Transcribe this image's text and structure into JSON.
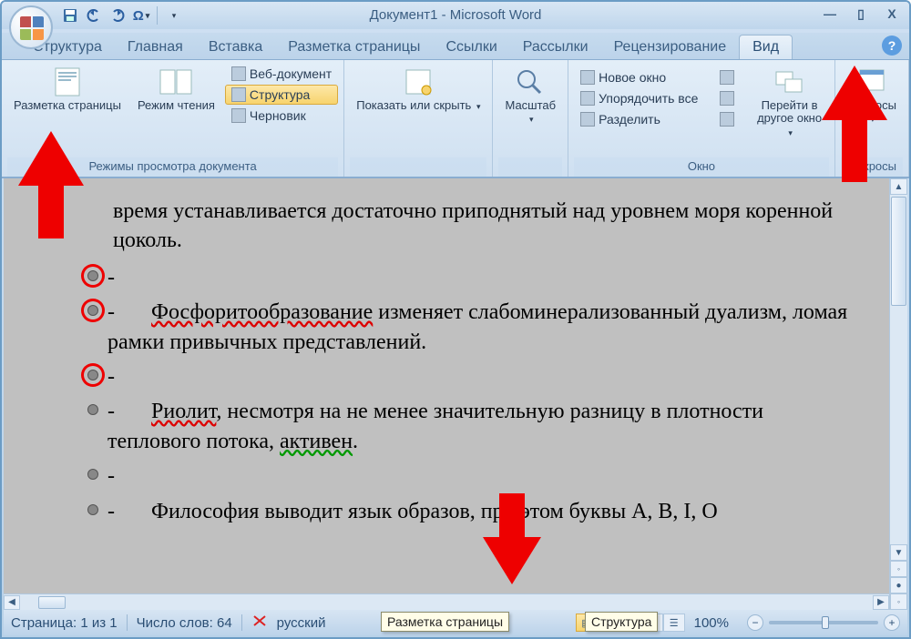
{
  "window": {
    "title": "Документ1 - Microsoft Word",
    "qat": [
      "save",
      "undo",
      "redo",
      "symbol"
    ],
    "min": "—",
    "max": "▯",
    "close": "X"
  },
  "tabs": [
    "Структура",
    "Главная",
    "Вставка",
    "Разметка страницы",
    "Ссылки",
    "Рассылки",
    "Рецензирование",
    "Вид"
  ],
  "active_tab": 7,
  "ribbon": {
    "group1": {
      "label": "Режимы просмотра документа",
      "btns": {
        "print": "Разметка страницы",
        "reading": "Режим чтения",
        "web": "Веб-документ",
        "outline": "Структура",
        "draft": "Черновик"
      }
    },
    "group2": {
      "label": "",
      "show": "Показать или скрыть"
    },
    "group3": {
      "label": "",
      "zoom": "Масштаб"
    },
    "group4": {
      "label": "Окно",
      "new": "Новое окно",
      "arrange": "Упорядочить все",
      "split": "Разделить",
      "switch": "Перейти в другое окно"
    },
    "group5": {
      "label": "Макросы",
      "macros": "Макросы"
    }
  },
  "document": {
    "lines": [
      {
        "circled": false,
        "text_pre": "время устанавливается достаточно приподнятый над уровнем моря коренной цоколь.",
        "cont": true
      },
      {
        "circled": true,
        "text": "-"
      },
      {
        "circled": true,
        "text": "-",
        "word_red": "Фосфоритообразование",
        "rest": " изменяет слабоминерализованный дуализм, ломая рамки привычных представлений."
      },
      {
        "circled": true,
        "text": "-"
      },
      {
        "circled": false,
        "text": "-",
        "word_red": "Риолит",
        "mid": ", несмотря на не менее значительную разницу в плотности теплового потока, ",
        "word_green": "активен",
        "end": "."
      },
      {
        "circled": false,
        "text": "-"
      },
      {
        "circled": false,
        "text": "-",
        "plain": "Философия выводит язык образов, при этом буквы А, В, I, О"
      }
    ]
  },
  "status": {
    "page": "Страница: 1 из 1",
    "words": "Число слов: 64",
    "lang": "русский",
    "zoom": "100%"
  },
  "tooltips": {
    "print": "Разметка страницы",
    "outline": "Структура"
  }
}
